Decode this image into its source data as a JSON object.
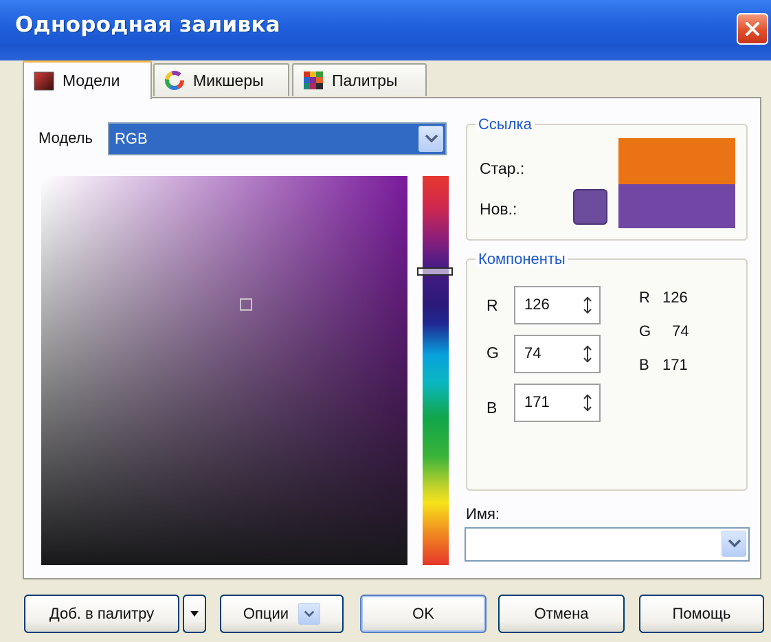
{
  "window": {
    "title": "Однородная заливка",
    "close_icon": "close-icon"
  },
  "tabs": [
    {
      "label": "Модели",
      "icon": "color-model-icon",
      "active": true
    },
    {
      "label": "Микшеры",
      "icon": "color-wheel-icon",
      "active": false
    },
    {
      "label": "Палитры",
      "icon": "palette-grid-icon",
      "active": false
    }
  ],
  "model": {
    "label": "Модель",
    "value": "RGB"
  },
  "reference": {
    "legend": "Ссылка",
    "old_label": "Стар.:",
    "new_label": "Нов.:",
    "old_color": "#ea7414",
    "new_color": "#7047a4"
  },
  "components": {
    "legend": "Компоненты",
    "fields": [
      {
        "channel": "R",
        "value": "126"
      },
      {
        "channel": "G",
        "value": "74"
      },
      {
        "channel": "B",
        "value": "171"
      }
    ],
    "readout": [
      {
        "channel": "R",
        "value": "126"
      },
      {
        "channel": "G",
        "value": "74"
      },
      {
        "channel": "B",
        "value": "171"
      }
    ]
  },
  "name": {
    "label": "Имя:",
    "value": ""
  },
  "buttons": {
    "add_to_palette": "Доб. в палитру",
    "options": "Опции",
    "ok": "OK",
    "cancel": "Отмена",
    "help": "Помощь"
  },
  "colors": {
    "titlebar": "#1f5fdc",
    "accent_text": "#1c57c8",
    "selection": "#316ac5"
  }
}
